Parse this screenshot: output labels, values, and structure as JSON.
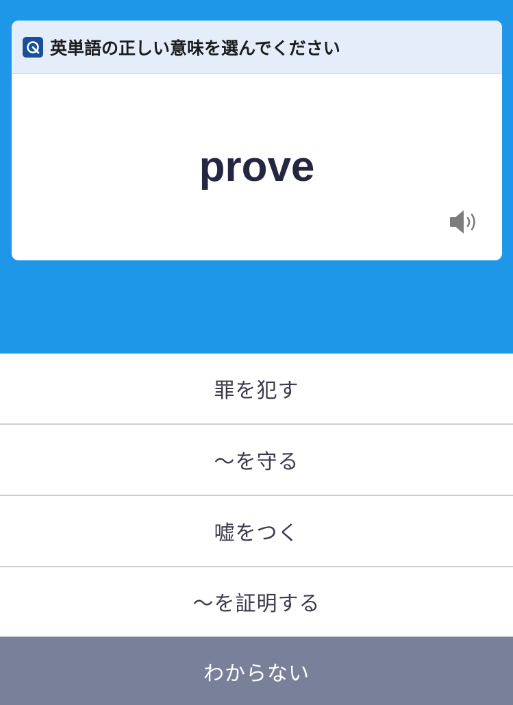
{
  "quiz": {
    "instruction": "英単語の正しい意味を選んでください",
    "word": "prove",
    "brand_icon": "quiz-logo-icon",
    "speaker_icon": "speaker-icon"
  },
  "choices": [
    {
      "label": "罪を犯す"
    },
    {
      "label": "～を守る"
    },
    {
      "label": "嘘をつく"
    },
    {
      "label": "～を証明する"
    }
  ],
  "skip": {
    "label": "わからない"
  },
  "colors": {
    "background": "#1e97e8",
    "header": "#e4edf9",
    "word": "#252742",
    "skip_button": "#78809a",
    "brand": "#1a4f9c"
  }
}
